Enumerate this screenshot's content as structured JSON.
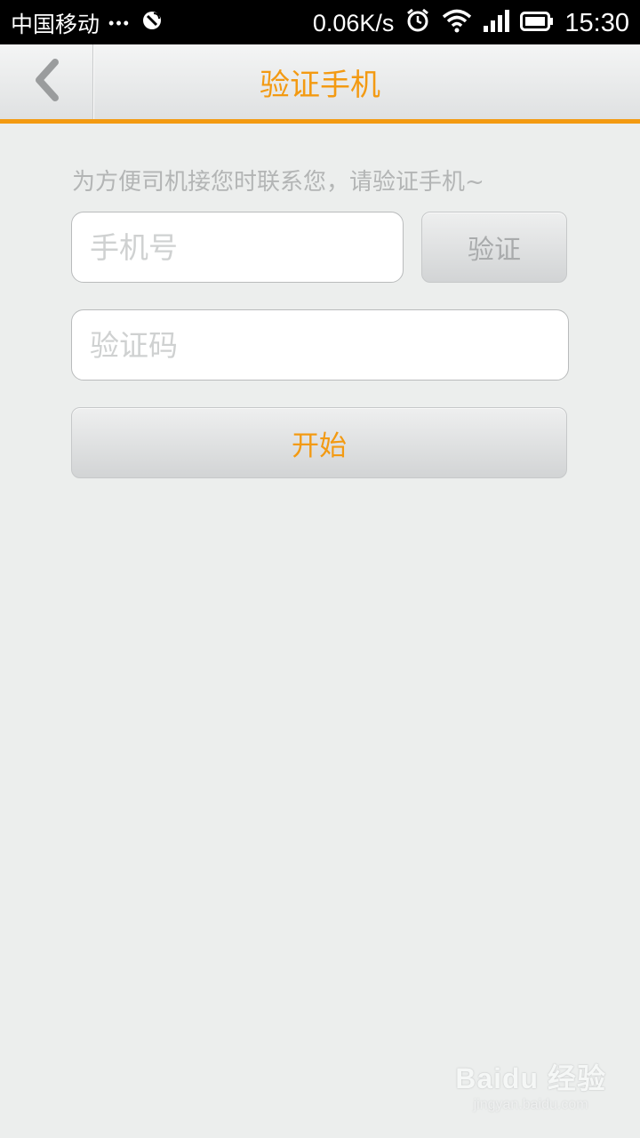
{
  "status_bar": {
    "carrier": "中国移动",
    "dots": "•••",
    "net_speed": "0.06K/s",
    "time": "15:30"
  },
  "header": {
    "title": "验证手机",
    "back_icon": "chevron-left-icon"
  },
  "form": {
    "hint": "为方便司机接您时联系您，请验证手机~",
    "phone_placeholder": "手机号",
    "verify_label": "验证",
    "code_placeholder": "验证码",
    "start_label": "开始"
  },
  "watermark": {
    "brand": "Baidu 经验",
    "url": "jingyan.baidu.com"
  },
  "colors": {
    "accent": "#f39a12",
    "background": "#eceeed",
    "placeholder": "#cfd1d1"
  }
}
